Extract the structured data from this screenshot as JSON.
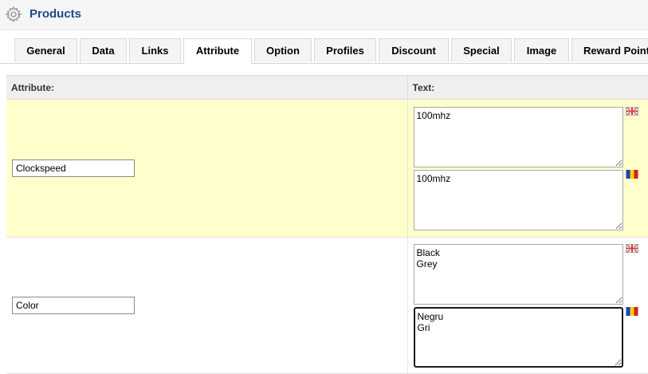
{
  "header": {
    "title": "Products",
    "icon": "gear-icon"
  },
  "tabs": [
    {
      "label": "General",
      "active": false
    },
    {
      "label": "Data",
      "active": false
    },
    {
      "label": "Links",
      "active": false
    },
    {
      "label": "Attribute",
      "active": true
    },
    {
      "label": "Option",
      "active": false
    },
    {
      "label": "Profiles",
      "active": false
    },
    {
      "label": "Discount",
      "active": false
    },
    {
      "label": "Special",
      "active": false
    },
    {
      "label": "Image",
      "active": false
    },
    {
      "label": "Reward Points",
      "active": false
    }
  ],
  "table": {
    "col_attribute": "Attribute:",
    "col_text": "Text:",
    "rows": [
      {
        "attribute": "Clockspeed",
        "texts": [
          {
            "lang": "english-flag-icon",
            "value": "100mhz"
          },
          {
            "lang": "romanian-flag-icon",
            "value": "100mhz"
          }
        ]
      },
      {
        "attribute": "Color",
        "texts": [
          {
            "lang": "english-flag-icon",
            "value": "Black\nGrey"
          },
          {
            "lang": "romanian-flag-icon",
            "value": "Negru\nGri"
          }
        ]
      }
    ]
  },
  "colors": {
    "title": "#1e4a8a",
    "highlight_row": "#ffffcc",
    "header_bg": "#efefef"
  }
}
